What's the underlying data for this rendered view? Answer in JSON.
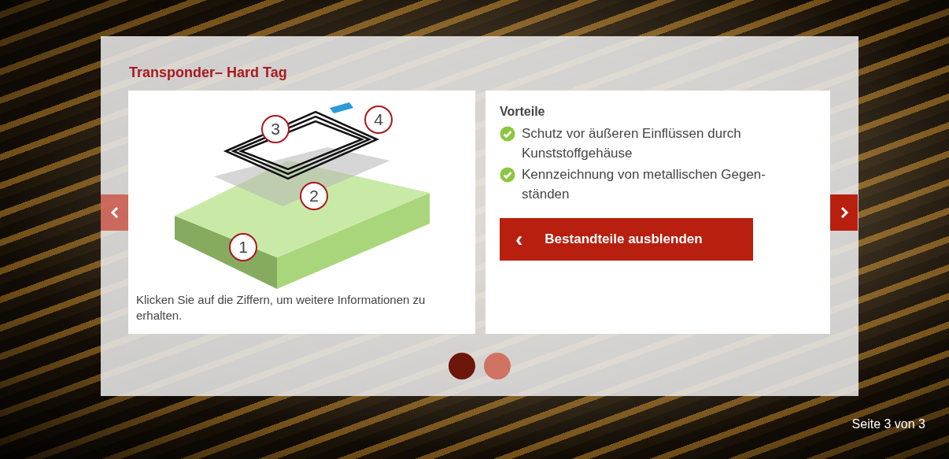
{
  "slide": {
    "title": "Transponder– Hard Tag",
    "diagram": {
      "hotspots": [
        {
          "label": "1"
        },
        {
          "label": "2"
        },
        {
          "label": "3"
        },
        {
          "label": "4"
        }
      ],
      "caption": "Klicken Sie auf die Ziffern, um weitere Informationen zu erhalten."
    },
    "advantages": {
      "heading": "Vorteile",
      "items": [
        {
          "text": "Schutz vor äußeren Einflüssen durch Kunststoffgehäuse"
        },
        {
          "text": "Kennzeichnung von metallischen Gegen-ständen"
        }
      ]
    },
    "action_button": {
      "icon": "‹",
      "label": "Bestandteile ausblenden"
    }
  },
  "prev_button": {
    "disabled": true
  },
  "next_button": {
    "disabled": false
  },
  "dots": [
    {
      "selected": true
    },
    {
      "selected": false
    }
  ],
  "page_indicator": "Seite 3 von 3"
}
